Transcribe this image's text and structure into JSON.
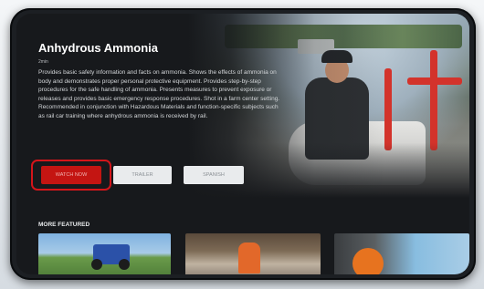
{
  "show": {
    "title": "Anhydrous Ammonia",
    "meta": "2min",
    "description": "Provides basic safety information and facts on ammonia. Shows the effects of ammonia on body and demonstrates proper personal protective equipment. Provides step-by-step procedures for the safe handling of ammonia. Presents measures to prevent exposure or releases and provides basic emergency response procedures. Shot in a farm center setting. Recommended in conjunction with Hazardous Materials and function-specific subjects such as rail car training where anhydrous ammonia is received by rail."
  },
  "actions": {
    "watch_label": "WATCH NOW",
    "trailer_label": "TRAILER",
    "spanish_label": "SPANISH"
  },
  "featured": {
    "heading": "MORE FEATURED"
  },
  "colors": {
    "accent": "#c41512",
    "highlight": "#d4151a",
    "background": "#17191c"
  }
}
